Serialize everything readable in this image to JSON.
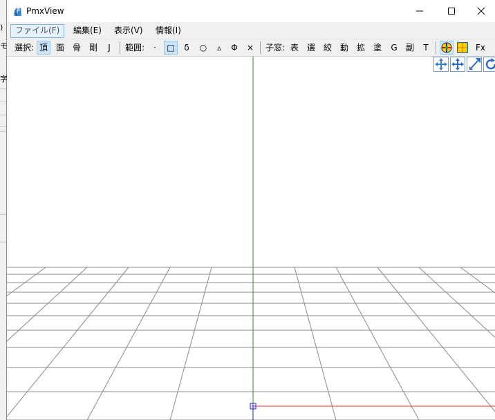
{
  "background_fragments": [
    ")",
    "モ",
    "字"
  ],
  "window": {
    "title": "PmxView",
    "minimize_glyph": "—",
    "maximize_glyph": "☐",
    "close_glyph": "✕"
  },
  "menu": {
    "file": "ファイル(F)",
    "edit": "編集(E)",
    "view": "表示(V)",
    "info": "情報(I)"
  },
  "toolbar": {
    "select_label": "選択:",
    "select_items": [
      "頂",
      "面",
      "骨",
      "剛",
      "J"
    ],
    "range_label": "範囲:",
    "range_items": [
      "·",
      "□",
      "δ",
      "○",
      "▵",
      "Φ",
      "×"
    ],
    "child_label": "子窓:",
    "child_items": [
      "表",
      "選",
      "絞",
      "動",
      "拡",
      "塗",
      "G",
      "副",
      "T"
    ],
    "fx_label": "Fx"
  },
  "colors": {
    "y_axis": "#2e8b2e",
    "x_axis": "#e03030",
    "z_axis": "#2020d0",
    "grid": "#8a8a8a"
  }
}
